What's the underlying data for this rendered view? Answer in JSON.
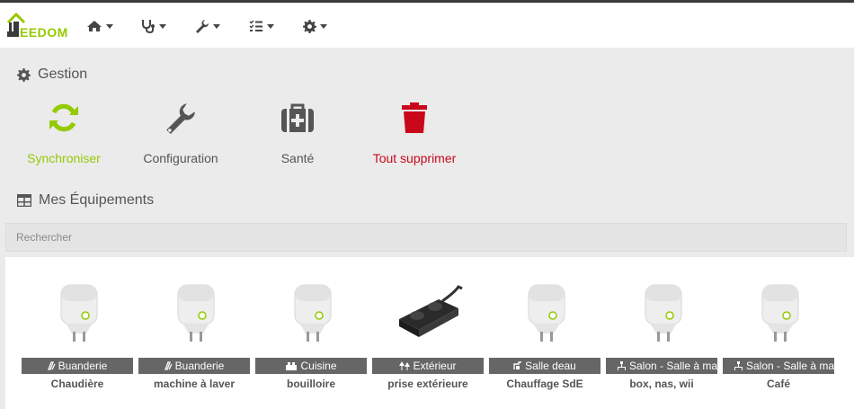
{
  "app": {
    "logo_text": "EEDOM",
    "brand_color": "#94ca02",
    "danger_color": "#c9071b"
  },
  "navbar": {
    "items": [
      {
        "icon": "home-icon"
      },
      {
        "icon": "stethoscope-icon"
      },
      {
        "icon": "wrench-icon"
      },
      {
        "icon": "checklist-icon"
      },
      {
        "icon": "gear-icon"
      }
    ]
  },
  "gestion": {
    "title": "Gestion",
    "actions": [
      {
        "label": "Synchroniser",
        "icon": "sync-icon"
      },
      {
        "label": "Configuration",
        "icon": "wrench-icon"
      },
      {
        "label": "Santé",
        "icon": "medical-kit-icon"
      },
      {
        "label": "Tout supprimer",
        "icon": "trash-icon"
      }
    ]
  },
  "equipements": {
    "title": "Mes Équipements",
    "search_placeholder": "Rechercher",
    "items": [
      {
        "room": "Buanderie",
        "room_icon": "laundry-icon",
        "name": "Chaudière",
        "image": "smart-plug"
      },
      {
        "room": "Buanderie",
        "room_icon": "laundry-icon",
        "name": "machine à laver",
        "image": "smart-plug"
      },
      {
        "room": "Cuisine",
        "room_icon": "kitchen-icon",
        "name": "bouilloire",
        "image": "smart-plug"
      },
      {
        "room": "Extérieur",
        "room_icon": "outdoor-icon",
        "name": "prise extérieure",
        "image": "outdoor-plug"
      },
      {
        "room": "Salle deau",
        "room_icon": "bathroom-icon",
        "name": "Chauffage SdE",
        "image": "smart-plug"
      },
      {
        "room": "Salon - Salle à manger",
        "room_icon": "living-room-icon",
        "name": "box, nas, wii",
        "image": "smart-plug"
      },
      {
        "room": "Salon - Salle à manger",
        "room_icon": "living-room-icon",
        "name": "Café",
        "image": "smart-plug"
      }
    ]
  }
}
